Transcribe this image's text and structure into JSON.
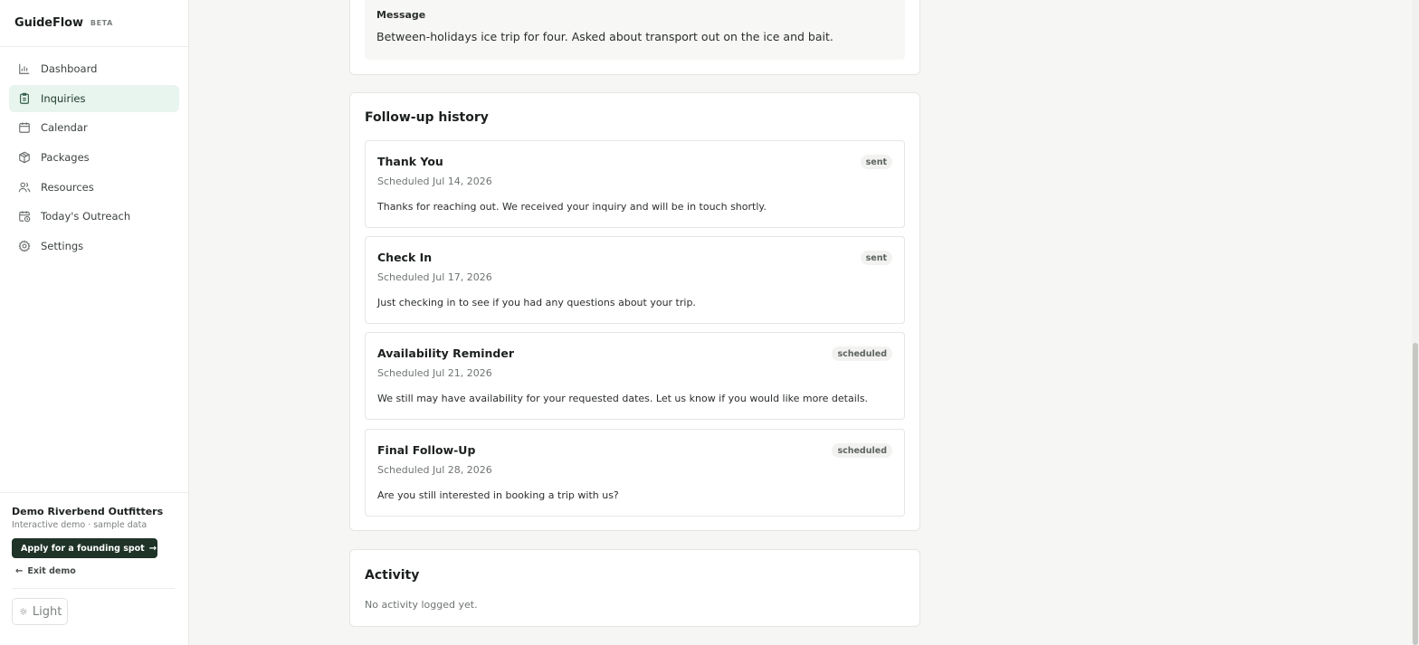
{
  "brand": {
    "name": "GuideFlow",
    "badge": "BETA"
  },
  "nav": {
    "items": [
      {
        "label": "Dashboard",
        "icon": "bar-chart-icon",
        "active": false
      },
      {
        "label": "Inquiries",
        "icon": "clipboard-icon",
        "active": true
      },
      {
        "label": "Calendar",
        "icon": "calendar-icon",
        "active": false
      },
      {
        "label": "Packages",
        "icon": "package-icon",
        "active": false
      },
      {
        "label": "Resources",
        "icon": "users-icon",
        "active": false
      },
      {
        "label": "Today's Outreach",
        "icon": "calendar-clock-icon",
        "active": false
      },
      {
        "label": "Settings",
        "icon": "gear-icon",
        "active": false
      }
    ]
  },
  "footer": {
    "org_name": "Demo Riverbend Outfitters",
    "org_sub": "Interactive demo · sample data",
    "apply_label": "Apply for a founding spot",
    "exit_label": "Exit demo",
    "theme_label": "Light"
  },
  "message": {
    "label": "Message",
    "text": "Between-holidays ice trip for four. Asked about transport out on the ice and bait."
  },
  "history": {
    "title": "Follow-up history",
    "items": [
      {
        "name": "Thank You",
        "date": "Scheduled Jul 14, 2026",
        "status": "sent",
        "body": "Thanks for reaching out. We received your inquiry and will be in touch shortly."
      },
      {
        "name": "Check In",
        "date": "Scheduled Jul 17, 2026",
        "status": "sent",
        "body": "Just checking in to see if you had any questions about your trip."
      },
      {
        "name": "Availability Reminder",
        "date": "Scheduled Jul 21, 2026",
        "status": "scheduled",
        "body": "We still may have availability for your requested dates. Let us know if you would like more details."
      },
      {
        "name": "Final Follow-Up",
        "date": "Scheduled Jul 28, 2026",
        "status": "scheduled",
        "body": "Are you still interested in booking a trip with us?"
      }
    ]
  },
  "activity": {
    "title": "Activity",
    "empty": "No activity logged yet."
  },
  "colors": {
    "accent_dark": "#1f3328",
    "active_nav_bg": "#e8f4ee",
    "page_bg": "#f6f6f5"
  }
}
